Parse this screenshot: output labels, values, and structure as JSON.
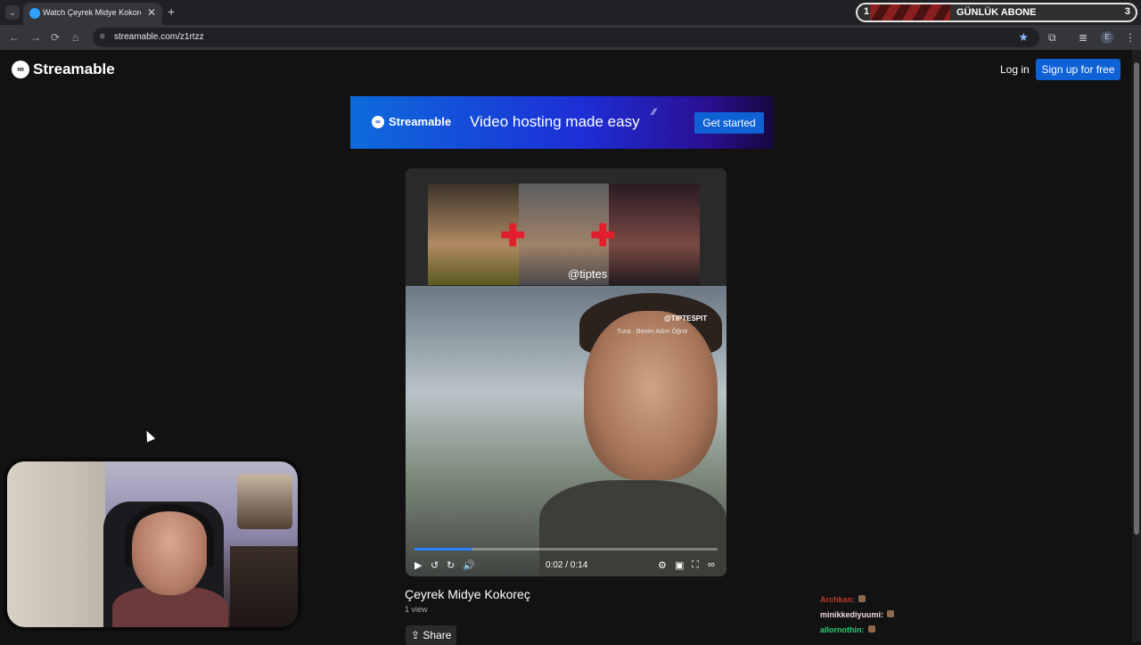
{
  "browser": {
    "tab_title": "Watch Çeyrek Midye Kokoreç |",
    "tab_close": "✕",
    "new_tab": "+",
    "tab_menu": "⌄",
    "url": "streamable.com/z1rtzz"
  },
  "overlay_banner": {
    "left_number": "1",
    "label": "GÜNLÜK ABONE",
    "right_number": "3"
  },
  "site": {
    "logo": "Streamable",
    "login": "Log in",
    "signup": "Sign up for free"
  },
  "ad": {
    "brand": "Streamable",
    "headline": "Video hosting made easy",
    "cta": "Get started"
  },
  "video": {
    "collage_handle": "@tiptes",
    "watermark_handle": "@TIPTESPIT",
    "song": "Tuna · Benim Adım Öğret",
    "current_time": "0:02",
    "duration": "0:14",
    "time_display": "0:02 / 0:14",
    "progress": 0.19,
    "title": "Çeyrek Midye Kokoreç",
    "views": "1 view",
    "share": "Share"
  },
  "chat": [
    {
      "user": "Archkan:",
      "color": "#c0392b"
    },
    {
      "user": "minikkediyuumi:",
      "color": "#f2d7e0"
    },
    {
      "user": "allornothin:",
      "color": "#2ecc71"
    }
  ],
  "icons": {
    "back": "←",
    "forward": "→",
    "reload": "⟳",
    "home": "⌂",
    "star": "★",
    "play": "▶",
    "rewind": "↺",
    "forward10": "↻",
    "volume": "🔊",
    "settings": "⚙",
    "pip": "▣",
    "fullscreen": "⛶",
    "share": "⇪"
  }
}
